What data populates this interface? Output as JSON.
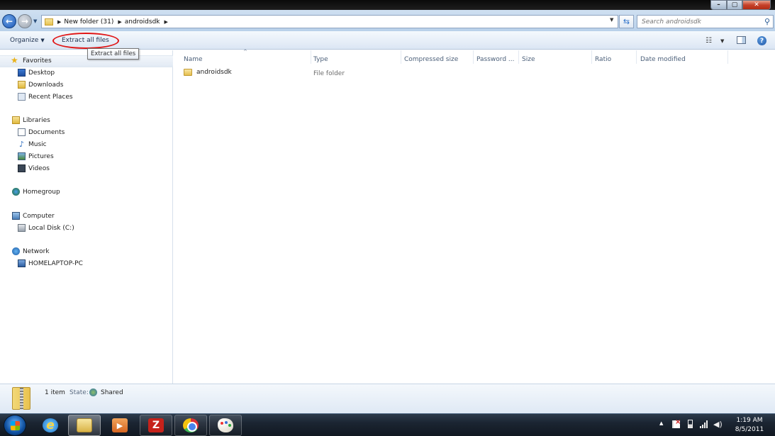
{
  "window": {
    "breadcrumbs": [
      "New folder (31)",
      "androidsdk"
    ],
    "search_placeholder": "Search androidsdk"
  },
  "toolbar": {
    "organize_label": "Organize",
    "extract_label": "Extract all files",
    "tooltip": "Extract all files"
  },
  "nav": {
    "favorites": "Favorites",
    "desktop": "Desktop",
    "downloads": "Downloads",
    "recent": "Recent Places",
    "libraries": "Libraries",
    "documents": "Documents",
    "music": "Music",
    "pictures": "Pictures",
    "videos": "Videos",
    "homegroup": "Homegroup",
    "computer": "Computer",
    "localdisk": "Local Disk (C:)",
    "network": "Network",
    "homelaptop": "HOMELAPTOP-PC"
  },
  "columns": {
    "name": "Name",
    "type": "Type",
    "compressed": "Compressed size",
    "password": "Password ...",
    "size": "Size",
    "ratio": "Ratio",
    "modified": "Date modified"
  },
  "files": [
    {
      "name": "androidsdk",
      "type": "File folder"
    }
  ],
  "details": {
    "item_count": "1 item",
    "state_label": "State:",
    "state_value": "Shared"
  },
  "taskbar": {
    "time": "1:19 AM",
    "date": "8/5/2011"
  },
  "colors": {
    "highlight_ring": "#e01616",
    "toolbar_text": "#1e3250"
  }
}
